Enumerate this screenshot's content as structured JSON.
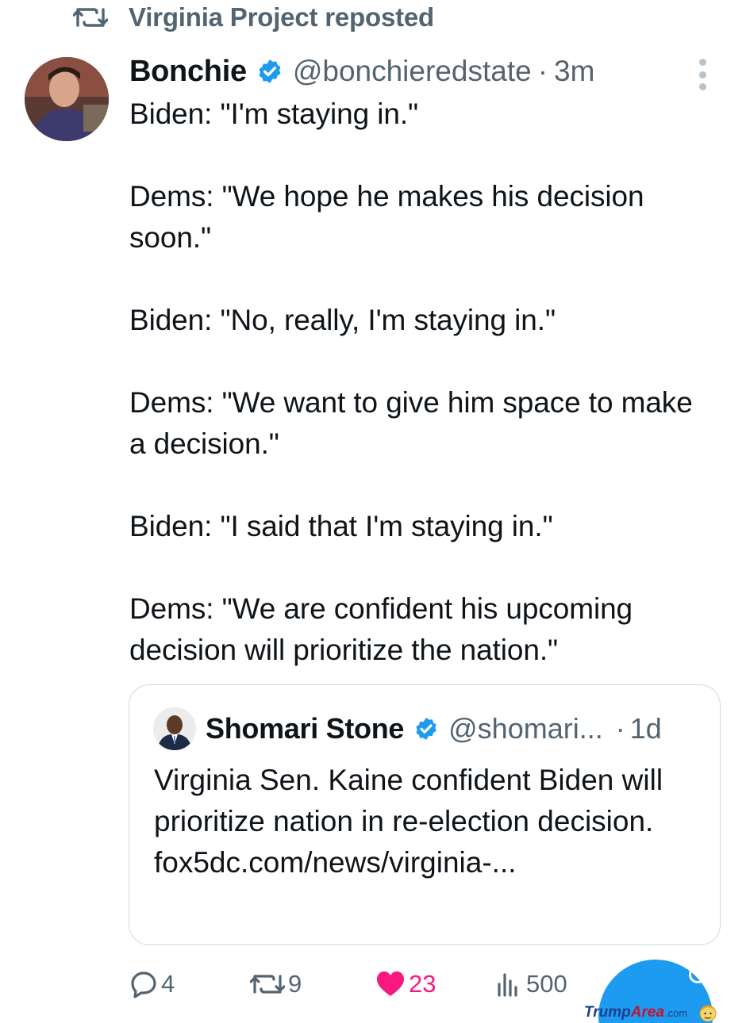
{
  "repost": {
    "label": "Virginia Project reposted",
    "icon": "repost-icon"
  },
  "tweet": {
    "author_name": "Bonchie",
    "verified": true,
    "handle": "@bonchieredstate",
    "separator": "·",
    "time": "3m",
    "paragraphs": [
      "Biden: \"I'm staying in.\"",
      "Dems: \"We hope he makes his decision soon.\"",
      "Biden: \"No, really, I'm staying in.\"",
      "Dems: \"We want to give him space to make a decision.\"",
      "Biden: \"I said that I'm staying in.\"",
      "Dems: \"We are confident his upcoming decision will prioritize the nation.\""
    ]
  },
  "quote": {
    "author_name": "Shomari Stone",
    "verified": true,
    "handle": "@shomari...",
    "separator": "·",
    "time": "1d",
    "text": "Virginia Sen. Kaine confident Biden will prioritize nation in re-election decision.",
    "link": "fox5dc.com/news/virginia-..."
  },
  "actions": {
    "replies": "4",
    "reposts": "9",
    "likes": "23",
    "views": "500"
  },
  "watermark": {
    "trump": "Trump",
    "area": "Area",
    "com": ".com"
  },
  "colors": {
    "accent": "#1d9bf0",
    "like": "#f91880",
    "muted": "#536471",
    "text": "#0f1419",
    "border": "#cfd9de"
  }
}
